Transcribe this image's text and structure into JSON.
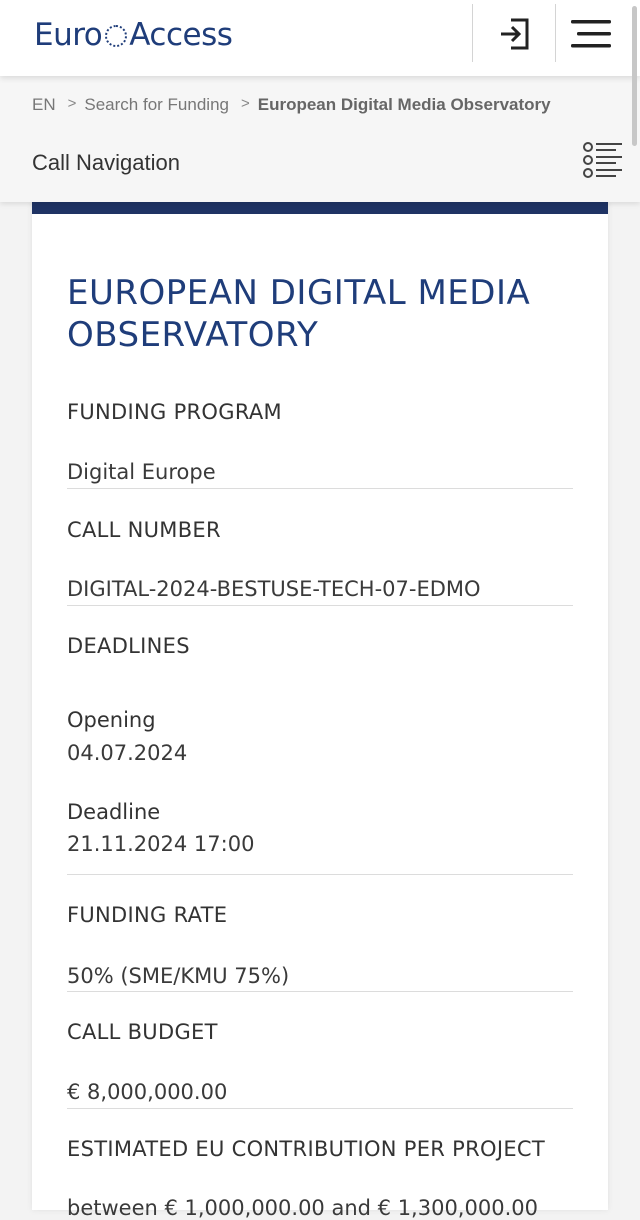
{
  "header": {
    "logo_left": "Euro",
    "logo_right": "Access",
    "login_icon": "login-icon",
    "menu_icon": "hamburger-menu-icon"
  },
  "breadcrumb": {
    "items": [
      "EN",
      "Search for Funding",
      "European Digital Media Observatory"
    ]
  },
  "call_navigation": {
    "label": "Call Navigation",
    "icon": "list-navigation-icon"
  },
  "call": {
    "title": "EUROPEAN DIGITAL MEDIA OBSERVATORY",
    "funding_program_label": "FUNDING PROGRAM",
    "funding_program": "Digital Europe",
    "call_number_label": "CALL NUMBER",
    "call_number": "DIGITAL-2024-BESTUSE-TECH-07-EDMO",
    "deadlines_label": "DEADLINES",
    "opening_label": "Opening",
    "opening_date": "04.07.2024",
    "deadline_label": "Deadline",
    "deadline_date": "21.11.2024 17:00",
    "funding_rate_label": "FUNDING RATE",
    "funding_rate": "50% (SME/KMU 75%)",
    "call_budget_label": "CALL BUDGET",
    "call_budget": "€ 8,000,000.00",
    "eu_contribution_label": "ESTIMATED EU CONTRIBUTION PER PROJECT",
    "eu_contribution": "between € 1,000,000.00 and € 1,300,000.00"
  },
  "colors": {
    "brand_blue": "#1f3d7a",
    "card_accent": "#1f3364"
  }
}
